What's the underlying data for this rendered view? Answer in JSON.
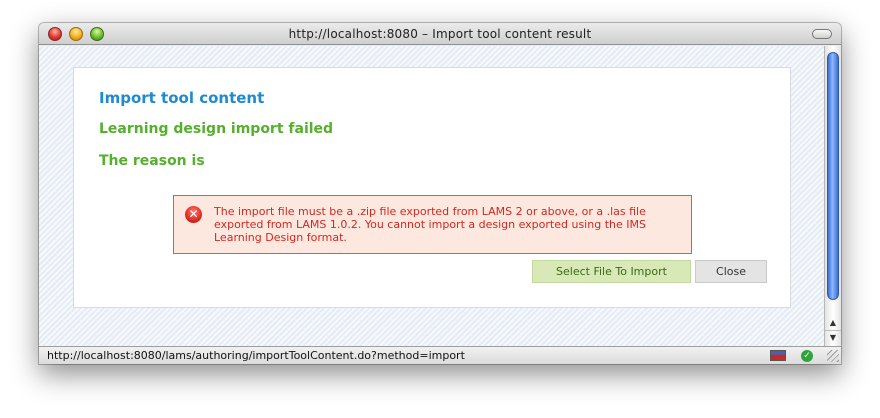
{
  "window": {
    "title": "http://localhost:8080 – Import tool content result"
  },
  "page": {
    "heading": "Import tool content",
    "failure_message": "Learning design import failed",
    "reason_label": "The reason is",
    "error": {
      "icon": "error-x-icon",
      "message": "The import file must be a .zip file exported from LAMS 2 or above, or a .las file exported from LAMS 1.0.2. You cannot import a design exported using the IMS Learning Design format."
    },
    "buttons": {
      "select_file": "Select File To Import",
      "close": "Close"
    }
  },
  "statusbar": {
    "url": "http://localhost:8080/lams/authoring/importToolContent.do?method=import"
  },
  "colors": {
    "heading_blue": "#1f8ad0",
    "status_green": "#55b02d",
    "error_red": "#cc2a22",
    "error_bg": "#fde8e0"
  }
}
